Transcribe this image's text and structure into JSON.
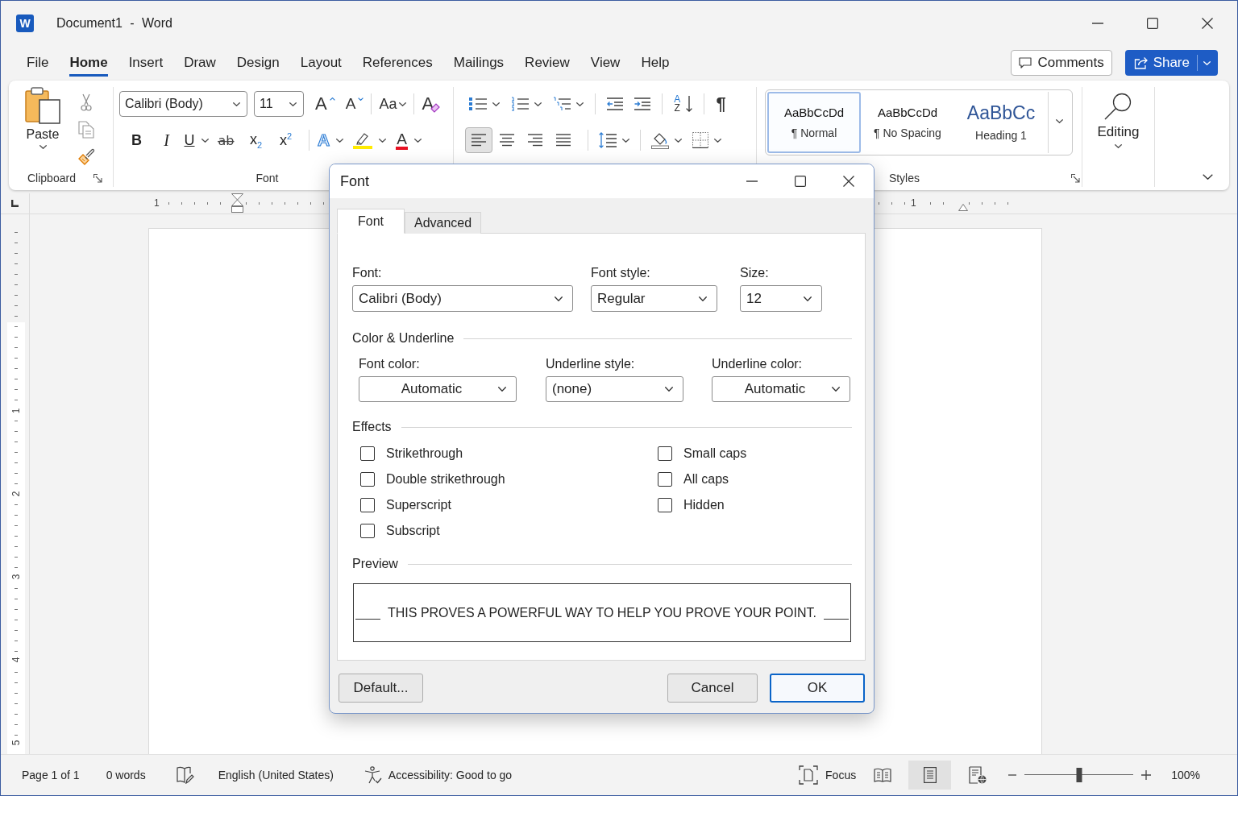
{
  "window": {
    "logo": "W",
    "title": "Document1 - Word"
  },
  "menu": {
    "tabs": [
      {
        "label": "File",
        "selected": false
      },
      {
        "label": "Home",
        "selected": true
      },
      {
        "label": "Insert",
        "selected": false
      },
      {
        "label": "Draw",
        "selected": false
      },
      {
        "label": "Design",
        "selected": false
      },
      {
        "label": "Layout",
        "selected": false
      },
      {
        "label": "References",
        "selected": false
      },
      {
        "label": "Mailings",
        "selected": false
      },
      {
        "label": "Review",
        "selected": false
      },
      {
        "label": "View",
        "selected": false
      },
      {
        "label": "Help",
        "selected": false
      }
    ],
    "comments_button": "Comments",
    "share_button": "Share"
  },
  "ribbon": {
    "clipboard": {
      "paste": "Paste",
      "label": "Clipboard"
    },
    "font": {
      "font_name": "Calibri (Body)",
      "font_size": "11",
      "grow": "A",
      "shrink": "A",
      "change_case": "Aa",
      "clear_formatting": "A",
      "format_buttons": [
        {
          "kind": "bold",
          "label": "B"
        },
        {
          "kind": "italic",
          "label": "I"
        },
        {
          "kind": "underline",
          "label": "U"
        },
        {
          "kind": "strikethrough",
          "label": "a̶b̶"
        },
        {
          "kind": "subscript",
          "label": "x$_{2}$"
        },
        {
          "kind": "superscript",
          "label": "x$^{2}$"
        }
      ],
      "text_effects": "A",
      "font_color": "A",
      "label": "Font"
    },
    "paragraph": {
      "sort": "AZ",
      "show_marks": "¶",
      "alignment": [
        {
          "kind": "left",
          "selected": true
        },
        {
          "kind": "center",
          "selected": false
        },
        {
          "kind": "right",
          "selected": false
        },
        {
          "kind": "justify",
          "selected": false
        }
      ]
    },
    "styles": {
      "items": [
        {
          "kind": "body",
          "sample": "AaBbCcDd",
          "name": "¶ Normal",
          "selected": true
        },
        {
          "kind": "body",
          "sample": "AaBbCcDd",
          "name": "¶ No Spacing",
          "selected": false
        },
        {
          "kind": "heading",
          "sample": "AaBbCc",
          "name": "Heading 1",
          "selected": false
        }
      ],
      "label": "Styles"
    },
    "editing": {
      "label": "Editing"
    }
  },
  "ruler": {
    "horizontal": [
      "1",
      "1"
    ],
    "vertical": [
      "1",
      "2",
      "3",
      "4",
      "5"
    ]
  },
  "dialog": {
    "title": "Font",
    "tabs": [
      {
        "label": "Font",
        "selected": true
      },
      {
        "label": "Advanced",
        "selected": false
      }
    ],
    "font_fields": [
      {
        "label": "Font:",
        "value": "Calibri (Body)"
      },
      {
        "label": "Font style:",
        "value": "Regular"
      },
      {
        "label": "Size:",
        "value": "12"
      }
    ],
    "color_underline": {
      "heading": "Color & Underline",
      "fields": [
        {
          "kind": "color",
          "label": "Font color:",
          "value": "Automatic"
        },
        {
          "kind": "list",
          "label": "Underline style:",
          "value": "(none)"
        },
        {
          "kind": "color",
          "label": "Underline color:",
          "value": "Automatic"
        }
      ]
    },
    "effects": {
      "heading": "Effects",
      "columns": [
        {
          "options": [
            {
              "label": "Strikethrough",
              "checked": false
            },
            {
              "label": "Double strikethrough",
              "checked": false
            },
            {
              "label": "Superscript",
              "checked": false
            },
            {
              "label": "Subscript",
              "checked": false
            }
          ]
        },
        {
          "options": [
            {
              "label": "Small caps",
              "checked": false
            },
            {
              "label": "All caps",
              "checked": false
            },
            {
              "label": "Hidden",
              "checked": false
            }
          ]
        }
      ]
    },
    "preview": {
      "heading": "Preview",
      "text": "THIS PROVES A POWERFUL WAY TO HELP YOU PROVE YOUR POINT."
    },
    "buttons": [
      {
        "kind": "set_default",
        "label": "Default..."
      },
      {
        "kind": "cancel",
        "label": "Cancel"
      },
      {
        "kind": "confirm",
        "label": "OK"
      }
    ]
  },
  "status_bar": {
    "page": "Page 1 of 1",
    "words": "0 words",
    "language": "English (United States)",
    "accessibility": "Accessibility: Good to go",
    "focus": "Focus",
    "views": [
      {
        "kind": "read",
        "selected": false
      },
      {
        "kind": "print",
        "selected": true
      },
      {
        "kind": "web",
        "selected": false
      }
    ],
    "zoom": {
      "level": 0.5,
      "reading": "100%"
    }
  }
}
